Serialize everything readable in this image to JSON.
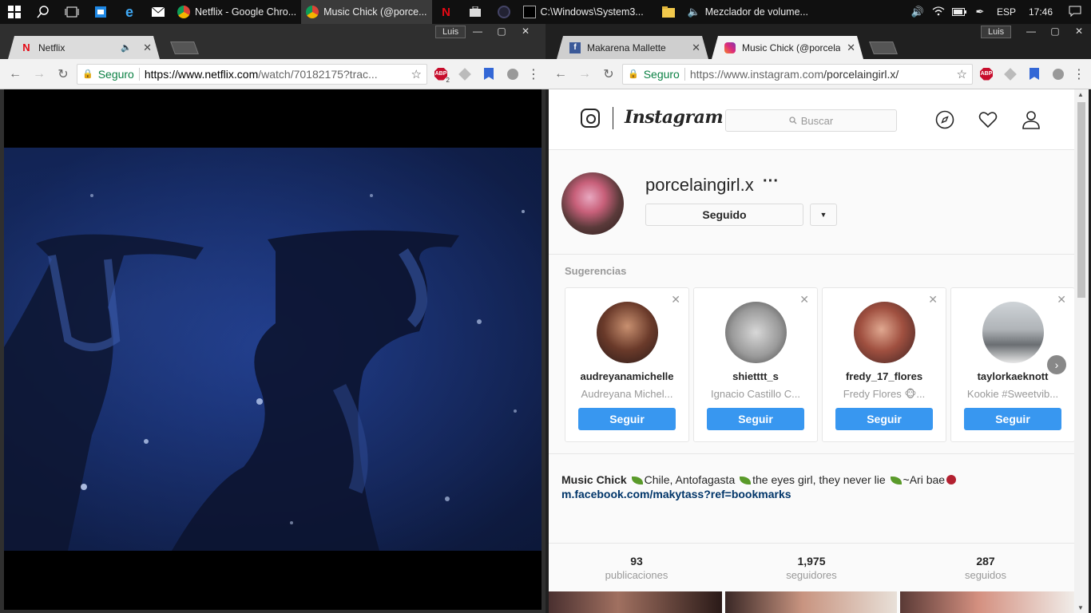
{
  "taskbar": {
    "tasks": [
      {
        "label": "Netflix - Google Chro...",
        "active": false
      },
      {
        "label": "Music Chick (@porce...",
        "active": true
      },
      {
        "label": "C:\\Windows\\System3...",
        "active": false
      },
      {
        "label": "Mezclador de volume...",
        "active": false
      }
    ],
    "lang": "ESP",
    "clock": "17:46"
  },
  "left_window": {
    "user": "Luis",
    "tab_title": "Netflix",
    "secure_label": "Seguro",
    "url_host": "https://www.netflix.com",
    "url_rest": "/watch/70182175?trac...",
    "abp_count": "2"
  },
  "right_window": {
    "user": "Luis",
    "tabs": [
      {
        "title": "Makarena Mallette"
      },
      {
        "title": "Music Chick (@porcelain..."
      }
    ],
    "secure_label": "Seguro",
    "url_host": "https://www.instagram.com",
    "url_rest": "/porcelaingirl.x/"
  },
  "instagram": {
    "wordmark": "Instagram",
    "search_placeholder": "Buscar",
    "username": "porcelaingirl.x",
    "following_button": "Seguido",
    "suggestions_title": "Sugerencias",
    "suggestions": [
      {
        "username": "audreyanamichelle",
        "fullname": "Audreyana Michel...",
        "button": "Seguir"
      },
      {
        "username": "shietttt_s",
        "fullname": "Ignacio Castillo C...",
        "button": "Seguir"
      },
      {
        "username": "fredy_17_flores",
        "fullname": "Fredy Flores 🐵...",
        "button": "Seguir"
      },
      {
        "username": "taylorkaeknott",
        "fullname": "Kookie #Sweetvib...",
        "button": "Seguir"
      }
    ],
    "bio_name": "Music Chick",
    "bio_part1": "Chile, Antofagasta",
    "bio_part2": "the eyes girl, they never lie",
    "bio_part3": "~Ari bae",
    "bio_link": "m.facebook.com/makytass?ref=bookmarks",
    "stats": [
      {
        "num": "93",
        "label": "publicaciones"
      },
      {
        "num": "1,975",
        "label": "seguidores"
      },
      {
        "num": "287",
        "label": "seguidos"
      }
    ]
  }
}
